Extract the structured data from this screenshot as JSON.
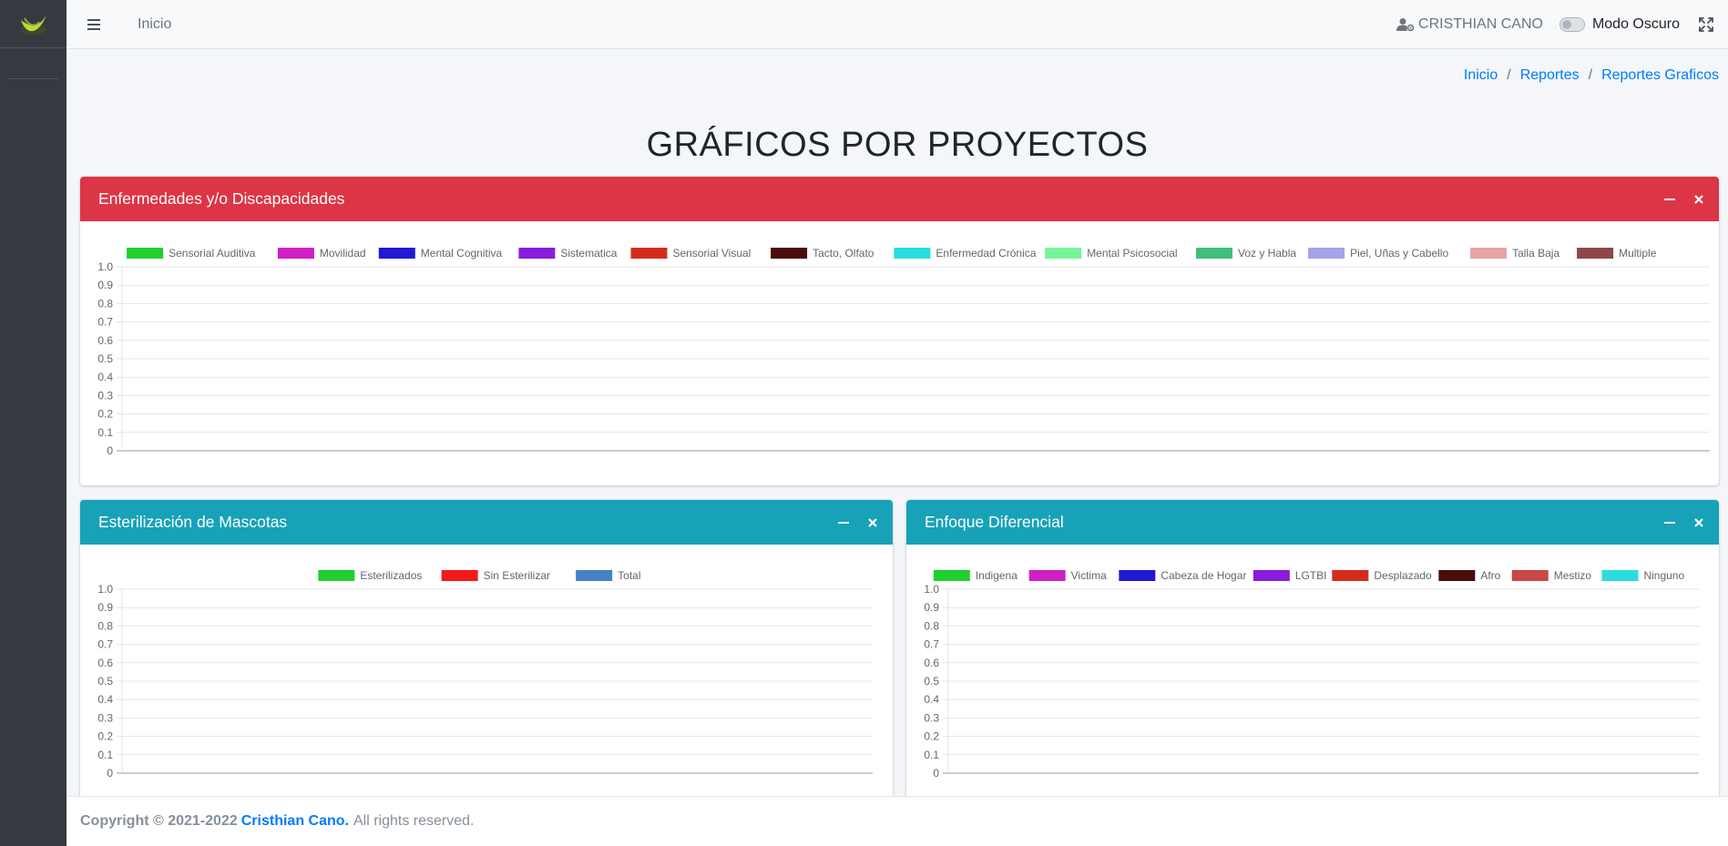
{
  "navbar": {
    "home_label": "Inicio",
    "user_name": "CRISTHIAN CANO",
    "dark_mode_label": "Modo Oscuro"
  },
  "breadcrumb": [
    "Inicio",
    "Reportes",
    "Reportes Graficos"
  ],
  "page_title": "GRÁFICOS POR PROYECTOS",
  "cards": [
    {
      "title": "Enfermedades y/o Discapacidades",
      "theme": "#dc3545"
    },
    {
      "title": "Esterilización de Mascotas",
      "theme": "#17a2b8"
    },
    {
      "title": "Enfoque Diferencial",
      "theme": "#17a2b8"
    }
  ],
  "chart_data": [
    {
      "type": "bar",
      "categories": [],
      "series": [
        {
          "name": "Sensorial Auditiva",
          "color": "#1fd02e",
          "values": []
        },
        {
          "name": "Movilidad",
          "color": "#d01fc4",
          "values": []
        },
        {
          "name": "Mental Cognitiva",
          "color": "#2218d4",
          "values": []
        },
        {
          "name": "Sistematica",
          "color": "#8a1cdc",
          "values": []
        },
        {
          "name": "Sensorial Visual",
          "color": "#d42c1c",
          "values": []
        },
        {
          "name": "Tacto, Olfato",
          "color": "#4a0c0c",
          "values": []
        },
        {
          "name": "Enfermedad Crónica",
          "color": "#2adcdc",
          "values": []
        },
        {
          "name": "Mental Psicosocial",
          "color": "#74f59a",
          "values": []
        },
        {
          "name": "Voz y Habla",
          "color": "#3fbf7a",
          "values": []
        },
        {
          "name": "Piel, Uñas y Cabello",
          "color": "#a3a3e8",
          "values": []
        },
        {
          "name": "Talla Baja",
          "color": "#e8a3a3",
          "values": []
        },
        {
          "name": "Multiple",
          "color": "#8f4646",
          "values": []
        }
      ],
      "ylim": [
        0,
        1.0
      ],
      "yticks": [
        "1.0",
        "0.9",
        "0.8",
        "0.7",
        "0.6",
        "0.5",
        "0.4",
        "0.3",
        "0.2",
        "0.1",
        "0"
      ],
      "grid": true,
      "legend": "top-center"
    },
    {
      "type": "bar",
      "categories": [],
      "series": [
        {
          "name": "Esterilizados",
          "color": "#1fd02e",
          "values": []
        },
        {
          "name": "Sin Esterilizar",
          "color": "#f21a1a",
          "values": []
        },
        {
          "name": "Total",
          "color": "#4682c4",
          "values": []
        }
      ],
      "ylim": [
        0,
        1.0
      ],
      "yticks": [
        "1.0",
        "0.9",
        "0.8",
        "0.7",
        "0.6",
        "0.5",
        "0.4",
        "0.3",
        "0.2",
        "0.1",
        "0"
      ],
      "grid": true,
      "legend": "top-center"
    },
    {
      "type": "bar",
      "categories": [],
      "series": [
        {
          "name": "Indigena",
          "color": "#1fd02e",
          "values": []
        },
        {
          "name": "Victima",
          "color": "#d01fc4",
          "values": []
        },
        {
          "name": "Cabeza de Hogar",
          "color": "#2218d4",
          "values": []
        },
        {
          "name": "LGTBI",
          "color": "#8a1cdc",
          "values": []
        },
        {
          "name": "Desplazado",
          "color": "#d42c1c",
          "values": []
        },
        {
          "name": "Afro",
          "color": "#4a0c0c",
          "values": []
        },
        {
          "name": "Mestizo",
          "color": "#c94747",
          "values": []
        },
        {
          "name": "Ninguno",
          "color": "#2adcdc",
          "values": []
        }
      ],
      "ylim": [
        0,
        1.0
      ],
      "yticks": [
        "1.0",
        "0.9",
        "0.8",
        "0.7",
        "0.6",
        "0.5",
        "0.4",
        "0.3",
        "0.2",
        "0.1",
        "0"
      ],
      "grid": true,
      "legend": "top-center"
    }
  ],
  "footer": {
    "copyright": "Copyright © 2021-2022",
    "author": "Cristhian Cano.",
    "rights": "All rights reserved."
  }
}
